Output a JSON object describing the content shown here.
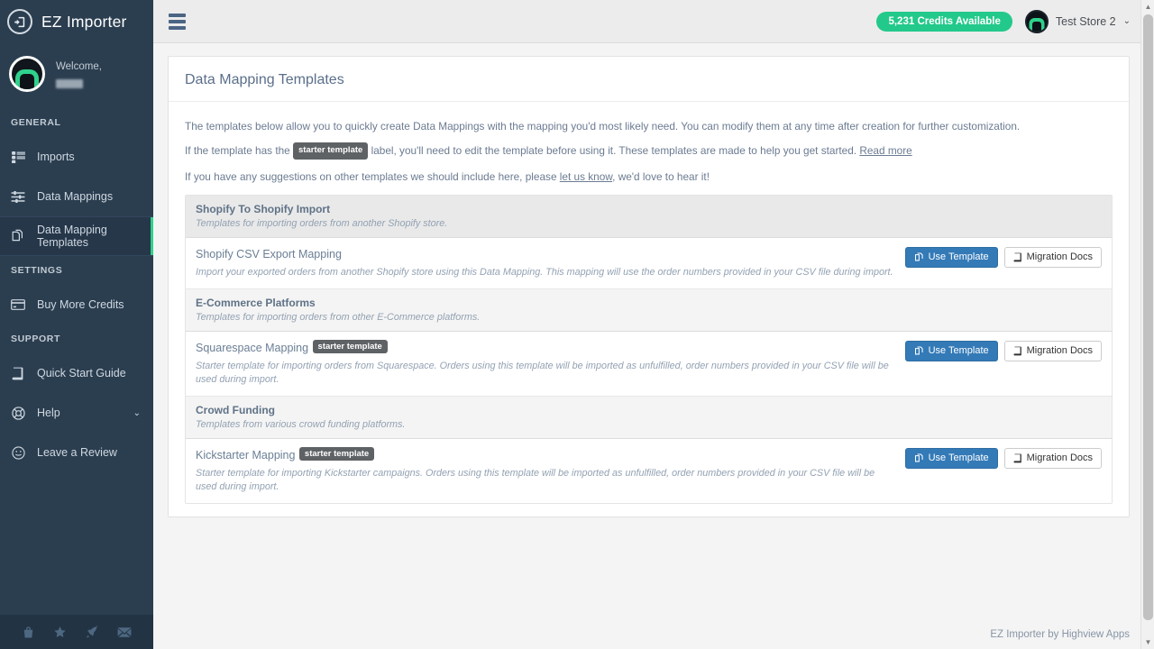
{
  "app": {
    "brand_title": "EZ Importer",
    "brand_logo_icon": "sign-in-icon"
  },
  "sidebar": {
    "welcome_label": "Welcome,",
    "sections": [
      {
        "title": "GENERAL"
      },
      {
        "title": "SETTINGS"
      },
      {
        "title": "SUPPORT"
      }
    ],
    "items_general": [
      {
        "label": "Imports",
        "icon": "list-icon"
      },
      {
        "label": "Data Mappings",
        "icon": "sliders-icon"
      },
      {
        "label": "Data Mapping Templates",
        "icon": "copy-files-icon",
        "active": true
      }
    ],
    "items_settings": [
      {
        "label": "Buy More Credits",
        "icon": "credit-card-icon"
      }
    ],
    "items_support": [
      {
        "label": "Quick Start Guide",
        "icon": "book-icon"
      },
      {
        "label": "Help",
        "icon": "life-ring-icon",
        "caret": "⌄"
      },
      {
        "label": "Leave a Review",
        "icon": "smiley-icon"
      }
    ],
    "footer_icons": [
      "shopping-bag-icon",
      "star-icon",
      "rocket-icon",
      "envelope-icon"
    ]
  },
  "topbar": {
    "menu_icon": "hamburger-icon",
    "credits_text": "5,231 Credits Available",
    "credits_color": "#22c98b",
    "store_name": "Test Store 2",
    "store_caret": "⌄"
  },
  "page": {
    "title": "Data Mapping Templates",
    "intro": {
      "p1": "The templates below allow you to quickly create Data Mappings with the mapping you'd most likely need. You can modify them at any time after creation for further customization.",
      "p2_before": "If the template has the",
      "p2_tag": "starter template",
      "p2_after": "label, you'll need to edit the template before using it. These templates are made to help you get started.",
      "p2_link": "Read more",
      "p3_before": "If you have any suggestions on other templates we should include here, please",
      "p3_link": "let us know",
      "p3_after": ", we'd love to hear it!"
    },
    "groups": [
      {
        "title": "Shopify To Shopify Import",
        "subtitle": "Templates for importing orders from another Shopify store.",
        "shade": "dark",
        "templates": [
          {
            "name": "Shopify CSV Export Mapping",
            "tag": "",
            "description": "Import your exported orders from another Shopify store using this Data Mapping. This mapping will use the order numbers provided in your CSV file during import.",
            "use_label": "Use Template",
            "docs_label": "Migration Docs"
          }
        ]
      },
      {
        "title": "E-Commerce Platforms",
        "subtitle": "Templates for importing orders from other E-Commerce platforms.",
        "shade": "light",
        "templates": [
          {
            "name": "Squarespace Mapping",
            "tag": "starter template",
            "description": "Starter template for importing orders from Squarespace. Orders using this template will be imported as unfulfilled, order numbers provided in your CSV file will be used during import.",
            "use_label": "Use Template",
            "docs_label": "Migration Docs"
          }
        ]
      },
      {
        "title": "Crowd Funding",
        "subtitle": "Templates from various crowd funding platforms.",
        "shade": "light",
        "templates": [
          {
            "name": "Kickstarter Mapping",
            "tag": "starter template",
            "description": "Starter template for importing Kickstarter campaigns. Orders using this template will be imported as unfulfilled, order numbers provided in your CSV file will be used during import.",
            "use_label": "Use Template",
            "docs_label": "Migration Docs"
          }
        ]
      }
    ]
  },
  "footer": {
    "text": "EZ Importer by Highview Apps"
  },
  "scrollbar": {
    "up_arrow": "▲",
    "down_arrow": "▼"
  }
}
